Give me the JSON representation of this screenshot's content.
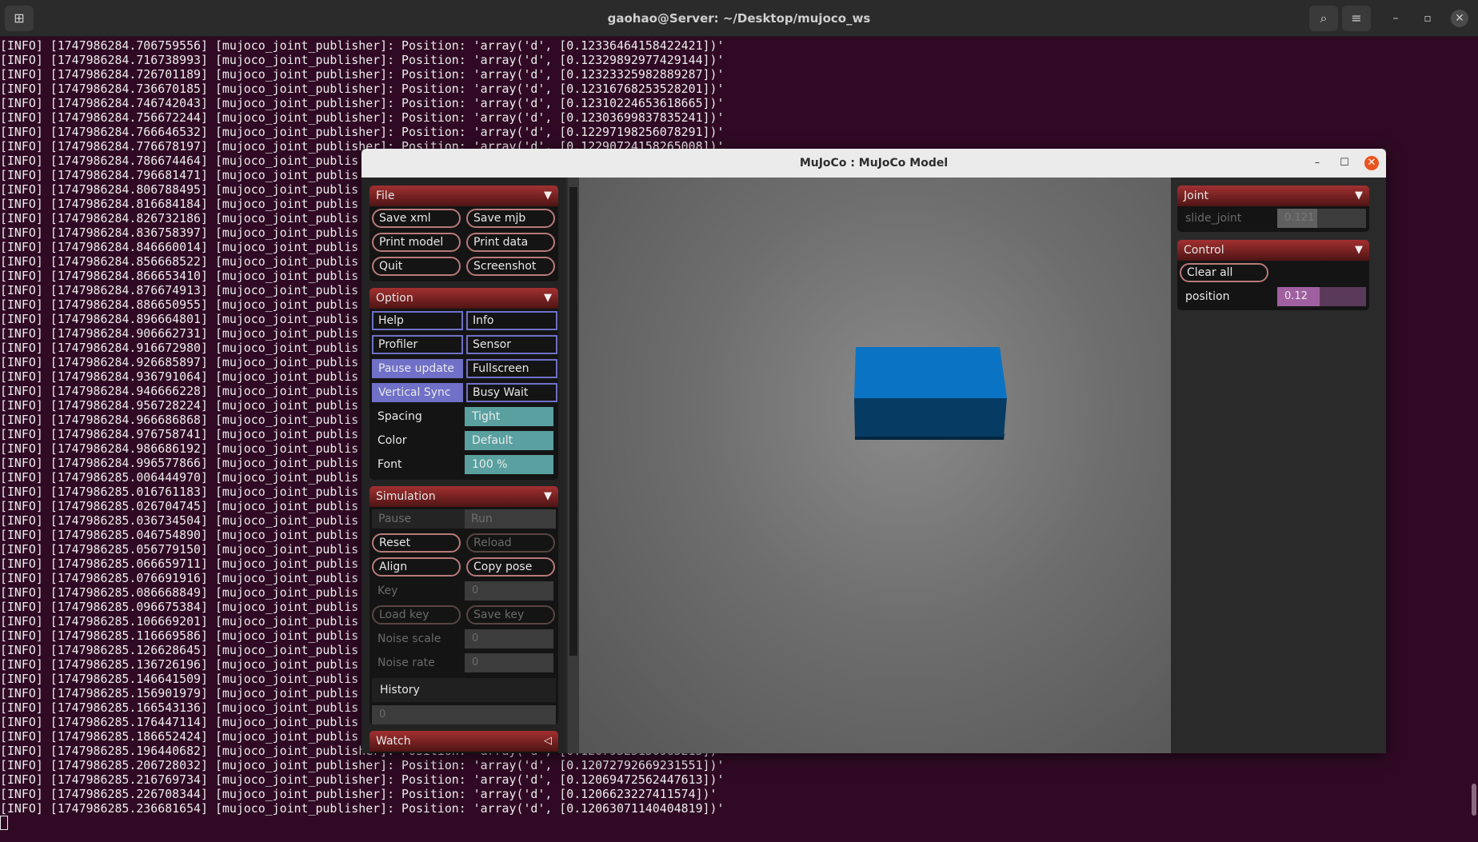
{
  "terminal": {
    "title": "gaohao@Server: ~/Desktop/mujoco_ws",
    "icons": {
      "new_tab": "new-tab-icon",
      "search": "search-icon",
      "menu": "hamburger-menu-icon",
      "minimize": "minimize-icon",
      "restore": "restore-icon",
      "close": "close-icon"
    },
    "glyphs": {
      "minimize": "–",
      "restore": "▫",
      "close": "✕",
      "search": "⌕",
      "menu": "≡",
      "new_tab": "⊞"
    },
    "lines": [
      "[INFO] [1747986284.706759556] [mujoco_joint_publisher]: Position: 'array('d', [0.12336464158422421])'",
      "[INFO] [1747986284.716738993] [mujoco_joint_publisher]: Position: 'array('d', [0.12329892977429144])'",
      "[INFO] [1747986284.726701189] [mujoco_joint_publisher]: Position: 'array('d', [0.12323325982889287])'",
      "[INFO] [1747986284.736670185] [mujoco_joint_publisher]: Position: 'array('d', [0.12316768253528201])'",
      "[INFO] [1747986284.746742043] [mujoco_joint_publisher]: Position: 'array('d', [0.12310224653618665])'",
      "[INFO] [1747986284.756672244] [mujoco_joint_publisher]: Position: 'array('d', [0.12303699837835241])'",
      "[INFO] [1747986284.766646532] [mujoco_joint_publisher]: Position: 'array('d', [0.12297198256078291])'",
      "[INFO] [1747986284.776678197] [mujoco_joint_publisher]: Position: 'array('d', [0.12290724158265008])'",
      "[INFO] [1747986284.786674464] [mujoco_joint_publis",
      "[INFO] [1747986284.796681471] [mujoco_joint_publis",
      "[INFO] [1747986284.806788495] [mujoco_joint_publis",
      "[INFO] [1747986284.816684184] [mujoco_joint_publis",
      "[INFO] [1747986284.826732186] [mujoco_joint_publis",
      "[INFO] [1747986284.836758397] [mujoco_joint_publis",
      "[INFO] [1747986284.846660014] [mujoco_joint_publis",
      "[INFO] [1747986284.856668522] [mujoco_joint_publis",
      "[INFO] [1747986284.866653410] [mujoco_joint_publis",
      "[INFO] [1747986284.876674913] [mujoco_joint_publis",
      "[INFO] [1747986284.886650955] [mujoco_joint_publis",
      "[INFO] [1747986284.896664801] [mujoco_joint_publis",
      "[INFO] [1747986284.906662731] [mujoco_joint_publis",
      "[INFO] [1747986284.916672980] [mujoco_joint_publis",
      "[INFO] [1747986284.926685897] [mujoco_joint_publis",
      "[INFO] [1747986284.936791064] [mujoco_joint_publis",
      "[INFO] [1747986284.946666228] [mujoco_joint_publis",
      "[INFO] [1747986284.956728224] [mujoco_joint_publis",
      "[INFO] [1747986284.966686868] [mujoco_joint_publis",
      "[INFO] [1747986284.976758741] [mujoco_joint_publis",
      "[INFO] [1747986284.986686192] [mujoco_joint_publis",
      "[INFO] [1747986284.996577866] [mujoco_joint_publis",
      "[INFO] [1747986285.006444970] [mujoco_joint_publis",
      "[INFO] [1747986285.016761183] [mujoco_joint_publis",
      "[INFO] [1747986285.026704745] [mujoco_joint_publis",
      "[INFO] [1747986285.036734504] [mujoco_joint_publis",
      "[INFO] [1747986285.046754890] [mujoco_joint_publis",
      "[INFO] [1747986285.056779150] [mujoco_joint_publis",
      "[INFO] [1747986285.066659711] [mujoco_joint_publis",
      "[INFO] [1747986285.076691916] [mujoco_joint_publis",
      "[INFO] [1747986285.086668849] [mujoco_joint_publis",
      "[INFO] [1747986285.096675384] [mujoco_joint_publis",
      "[INFO] [1747986285.106669201] [mujoco_joint_publis",
      "[INFO] [1747986285.116669586] [mujoco_joint_publis",
      "[INFO] [1747986285.126628645] [mujoco_joint_publis",
      "[INFO] [1747986285.136726196] [mujoco_joint_publis",
      "[INFO] [1747986285.146641509] [mujoco_joint_publis",
      "[INFO] [1747986285.156901979] [mujoco_joint_publis",
      "[INFO] [1747986285.166543136] [mujoco_joint_publis",
      "[INFO] [1747986285.176447114] [mujoco_joint_publis",
      "[INFO] [1747986285.186652424] [mujoco_joint_publis",
      "[INFO] [1747986285.196440682] [mujoco_joint_publisher]: Position: 'array('d', [0.12079325150965215])'",
      "[INFO] [1747986285.206728032] [mujoco_joint_publisher]: Position: 'array('d', [0.12072792669231551])'",
      "[INFO] [1747986285.216769734] [mujoco_joint_publisher]: Position: 'array('d', [0.12069472562447613])'",
      "[INFO] [1747986285.226708344] [mujoco_joint_publisher]: Position: 'array('d', [0.1206623227411574])'",
      "[INFO] [1747986285.236681654] [mujoco_joint_publisher]: Position: 'array('d', [0.12063071140404819])'"
    ]
  },
  "mujoco": {
    "title": "MuJoCo : MuJoCo Model",
    "window_icons": {
      "minimize": "minimize-icon",
      "maximize": "maximize-icon",
      "close": "close-icon"
    },
    "window_glyphs": {
      "minimize": "–",
      "maximize": "☐",
      "close": "✕"
    },
    "collapse_glyph": "▼",
    "expand_glyph": "◁",
    "file": {
      "title": "File",
      "buttons": [
        "Save xml",
        "Save mjb",
        "Print model",
        "Print data",
        "Quit",
        "Screenshot"
      ]
    },
    "option": {
      "title": "Option",
      "checkboxes": [
        {
          "label": "Help",
          "on": false
        },
        {
          "label": "Info",
          "on": false
        },
        {
          "label": "Profiler",
          "on": false
        },
        {
          "label": "Sensor",
          "on": false
        },
        {
          "label": "Pause update",
          "on": true
        },
        {
          "label": "Fullscreen",
          "on": false
        },
        {
          "label": "Vertical Sync",
          "on": true
        },
        {
          "label": "Busy Wait",
          "on": false
        }
      ],
      "selects": [
        {
          "label": "Spacing",
          "value": "Tight"
        },
        {
          "label": "Color",
          "value": "Default"
        },
        {
          "label": "Font",
          "value": "100 %"
        }
      ]
    },
    "simulation": {
      "title": "Simulation",
      "run_mode": {
        "pause": "Pause",
        "run": "Run"
      },
      "reset": "Reset",
      "reload": "Reload",
      "align": "Align",
      "copy_pose": "Copy pose",
      "key_label": "Key",
      "key_value": "0",
      "load_key": "Load key",
      "save_key": "Save key",
      "noise_scale_label": "Noise scale",
      "noise_scale_value": "0",
      "noise_rate_label": "Noise rate",
      "noise_rate_value": "0",
      "history_label": "History",
      "history_value": "0"
    },
    "watch": {
      "title": "Watch"
    },
    "joint": {
      "title": "Joint",
      "name": "slide_joint",
      "value": "0.121",
      "fraction": 0.45
    },
    "control": {
      "title": "Control",
      "clear_all": "Clear all",
      "name": "position",
      "value": "0.12",
      "fraction": 0.48
    },
    "scene": {
      "box_top": "#0b73c4",
      "box_front": "#063b63",
      "box_edge": "#03263f"
    }
  }
}
